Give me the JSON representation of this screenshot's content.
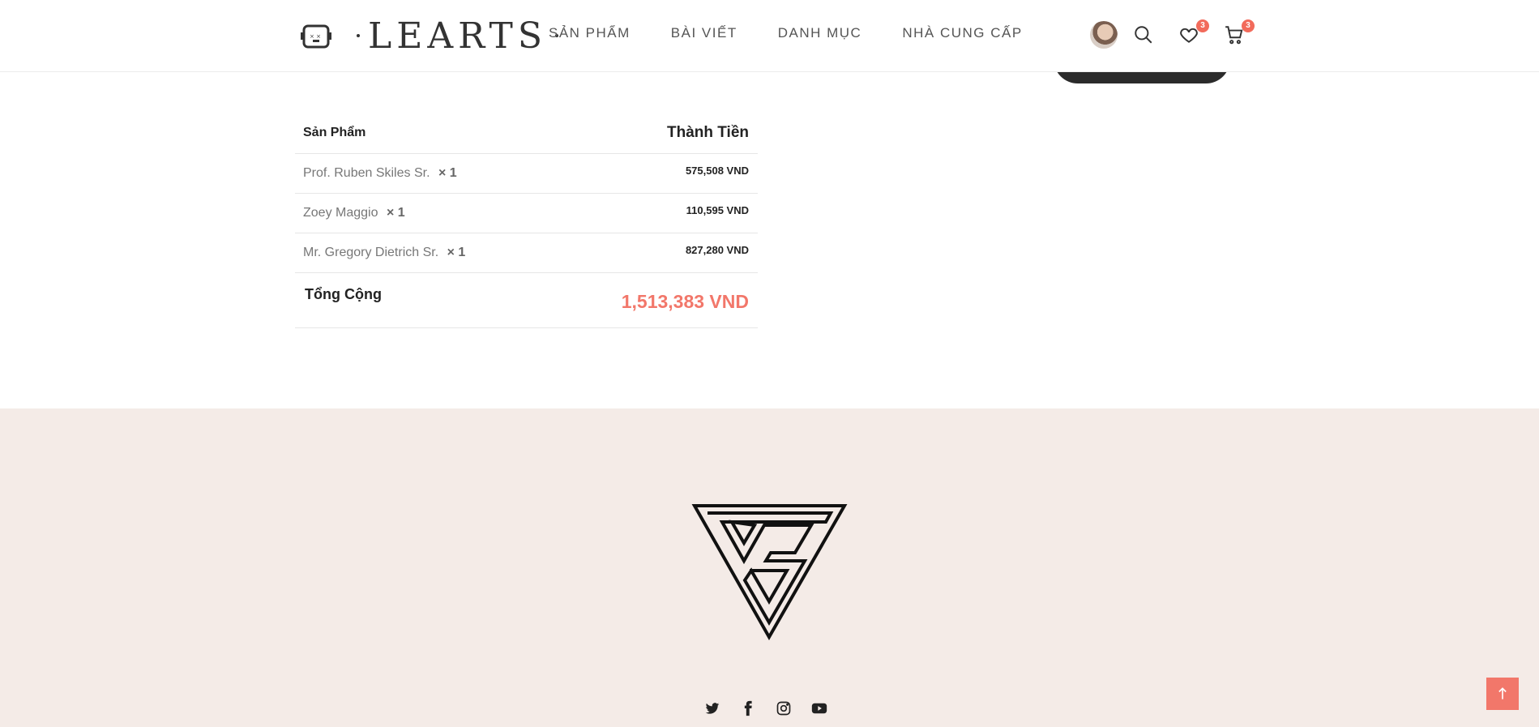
{
  "brand": {
    "name": "LEARTS"
  },
  "nav": {
    "items": [
      {
        "label": "SẢN PHẨM"
      },
      {
        "label": "BÀI VIẾT"
      },
      {
        "label": "DANH MỤC"
      },
      {
        "label": "NHÀ CUNG CẤP"
      }
    ]
  },
  "header": {
    "wishlist_count": "3",
    "cart_count": "3"
  },
  "order": {
    "col_product": "Sản Phẩm",
    "col_total": "Thành Tiền",
    "items": [
      {
        "name": "Prof. Ruben Skiles Sr.",
        "qty": "× 1",
        "price": "575,508 VND"
      },
      {
        "name": "Zoey Maggio",
        "qty": "× 1",
        "price": "110,595 VND"
      },
      {
        "name": "Mr. Gregory Dietrich Sr.",
        "qty": "× 1",
        "price": "827,280 VND"
      }
    ],
    "total_label": "Tổng Cộng",
    "total_value": "1,513,383 VND"
  },
  "colors": {
    "accent": "#f2776a",
    "footer_bg": "#f4ebe7",
    "dark_button": "#2b2b2b"
  },
  "icons": [
    "robot-face-icon",
    "search-icon",
    "heart-icon",
    "cart-icon",
    "twitter-icon",
    "facebook-icon",
    "instagram-icon",
    "youtube-icon",
    "arrow-up-icon"
  ]
}
